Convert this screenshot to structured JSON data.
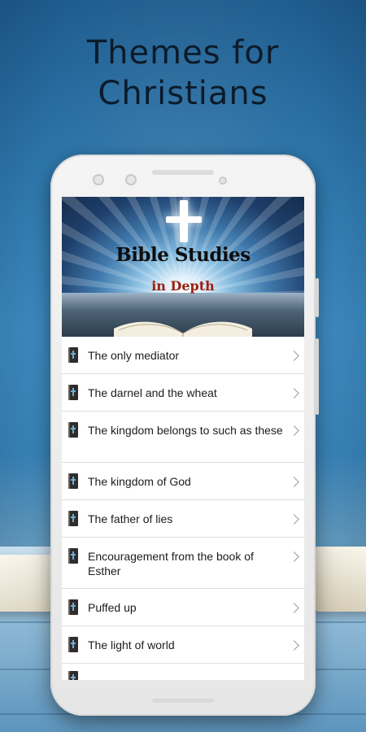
{
  "headline": {
    "line1": "Themes for",
    "line2": "Christians"
  },
  "banner": {
    "title": "Bible Studies",
    "subtitle": "in Depth"
  },
  "topics": [
    {
      "label": "The only mediator"
    },
    {
      "label": "The darnel and the wheat"
    },
    {
      "label": "The kingdom belongs to such as these"
    },
    {
      "label": "The kingdom of God"
    },
    {
      "label": "The father of lies"
    },
    {
      "label": "Encouragement from the book of Esther"
    },
    {
      "label": "Puffed up"
    },
    {
      "label": "The light of world"
    }
  ],
  "icons": {
    "row_icon": "bible-icon",
    "row_arrow": "chevron-right-icon"
  },
  "colors": {
    "background": "#3d89bf",
    "subtitle_red": "#9b1f12",
    "headline": "#0c1b2a"
  }
}
